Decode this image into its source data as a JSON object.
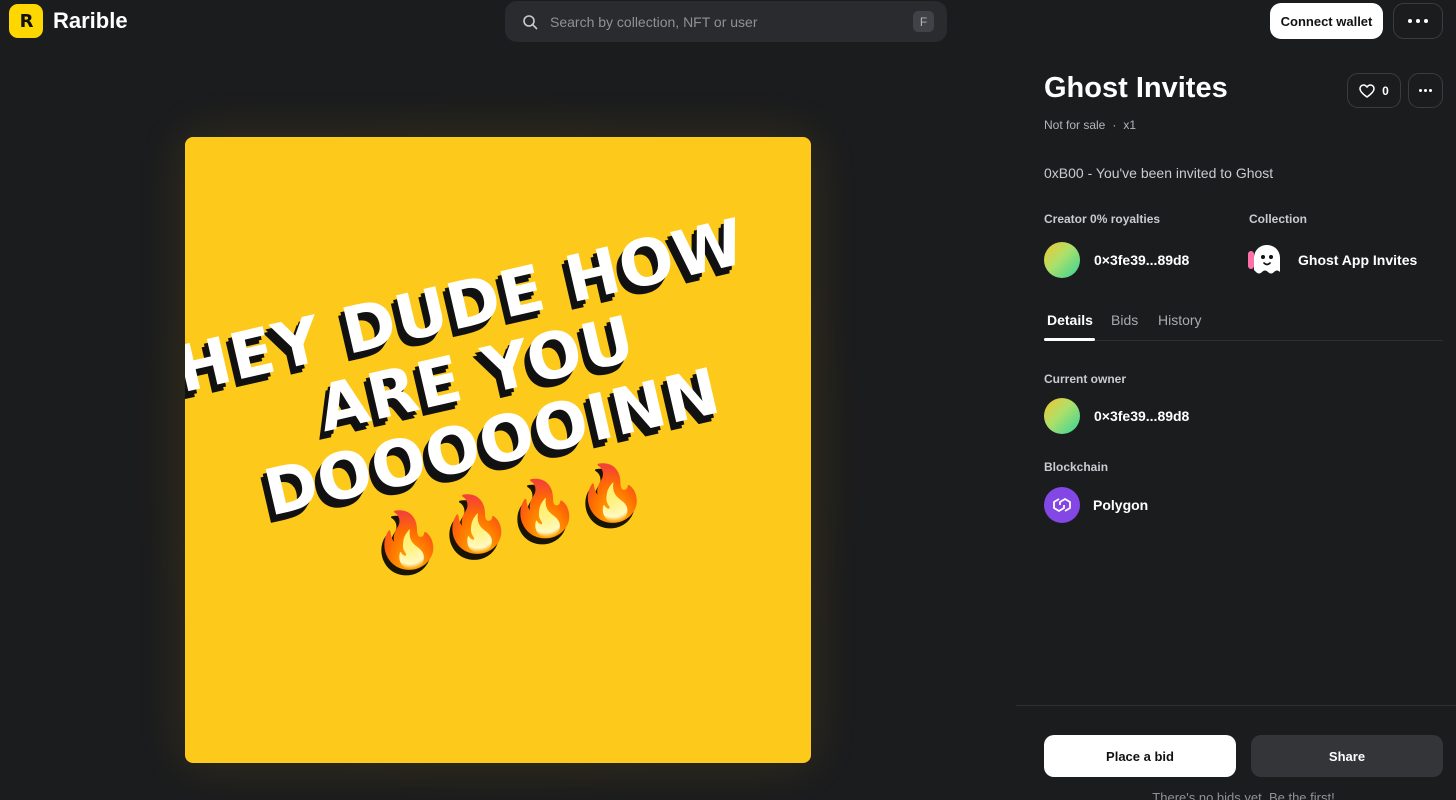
{
  "header": {
    "logo_letter": "R",
    "brand": "Rarible",
    "search": {
      "placeholder": "Search by collection, NFT or user",
      "shortcut": "F"
    },
    "connect_wallet": "Connect wallet",
    "more_icon": "more-horizontal-icon"
  },
  "artwork": {
    "lines": [
      "HEY DUDE HOW",
      "ARE YOU",
      "DOOOOOINN"
    ],
    "fires": "🔥🔥🔥🔥",
    "background_color": "#fdc91b"
  },
  "item": {
    "title": "Ghost Invites",
    "like_count": "0",
    "sale_status": "Not for sale",
    "separator": "·",
    "edition": "x1",
    "description": "0xB00 - You've been invited to Ghost",
    "creator_label": "Creator 0% royalties",
    "creator_name": "0×3fe39...89d8",
    "collection_label": "Collection",
    "collection_name": "Ghost App Invites"
  },
  "tabs": [
    "Details",
    "Bids",
    "History"
  ],
  "details": {
    "owner_label": "Current owner",
    "owner_name": "0×3fe39...89d8",
    "blockchain_label": "Blockchain",
    "blockchain_name": "Polygon",
    "blockchain_color": "#8247e5"
  },
  "actions": {
    "place_bid": "Place a bid",
    "share": "Share",
    "no_bids": "There's no bids yet. Be the first!"
  }
}
